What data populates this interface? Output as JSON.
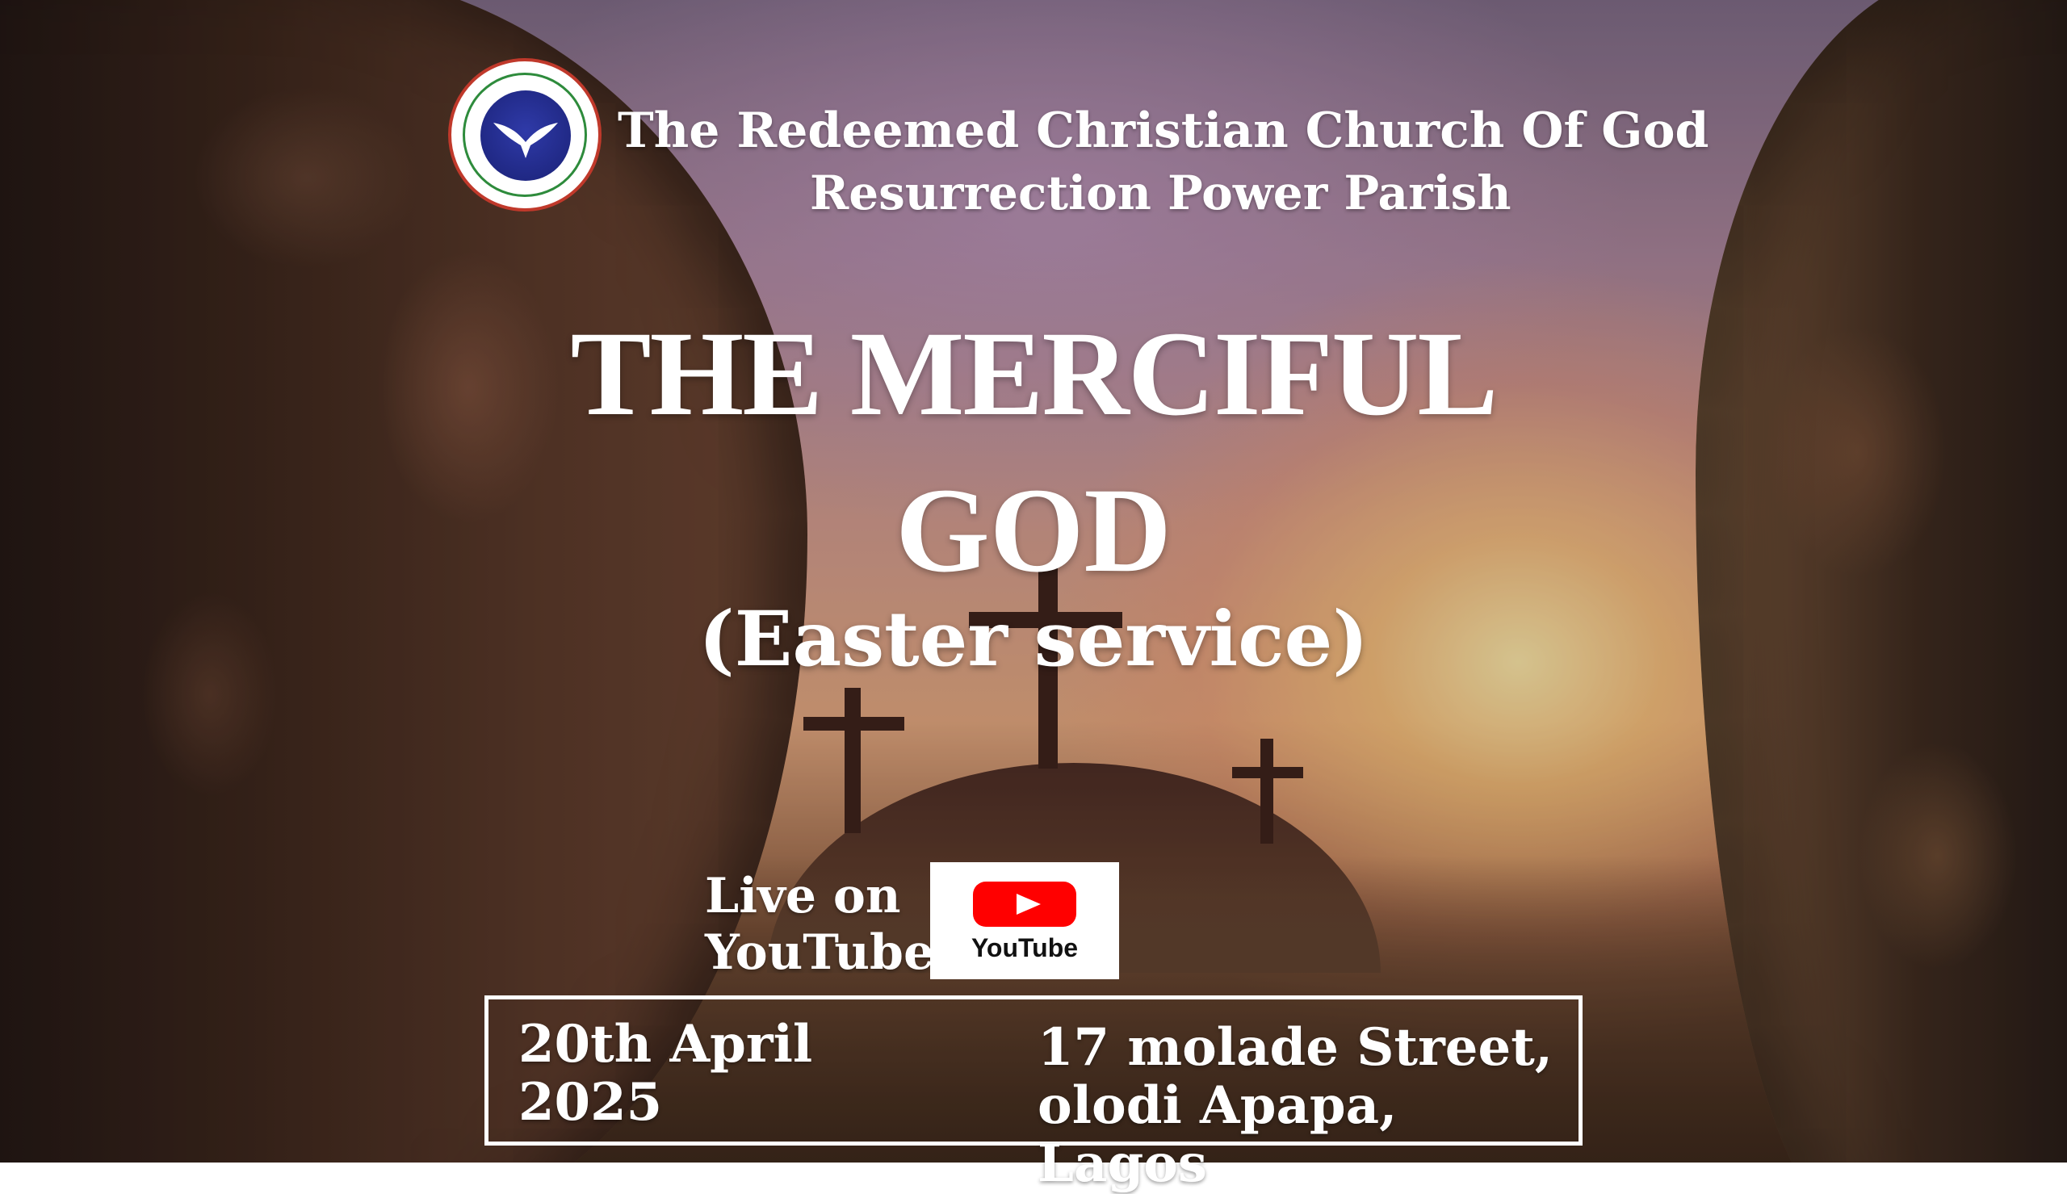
{
  "header": {
    "logo_text": "THE REDEEMED CHRISTIAN CHURCH OF GOD",
    "church_name": "The Redeemed Christian Church Of God",
    "parish_name": "Resurrection Power Parish"
  },
  "event": {
    "title_line1": "THE MERCIFUL",
    "title_line2": "GOD",
    "subtitle": "(Easter service)"
  },
  "stream": {
    "live_line1": "Live on",
    "live_line2": "YouTube",
    "badge_label": "YouTube",
    "badge_icon": "youtube-play-icon",
    "brand_color": "#FF0000"
  },
  "details": {
    "date_line1": "20th April",
    "date_line2": "2025",
    "address_line1": "17 molade Street,",
    "address_line2": "olodi Apapa, Lagos"
  }
}
